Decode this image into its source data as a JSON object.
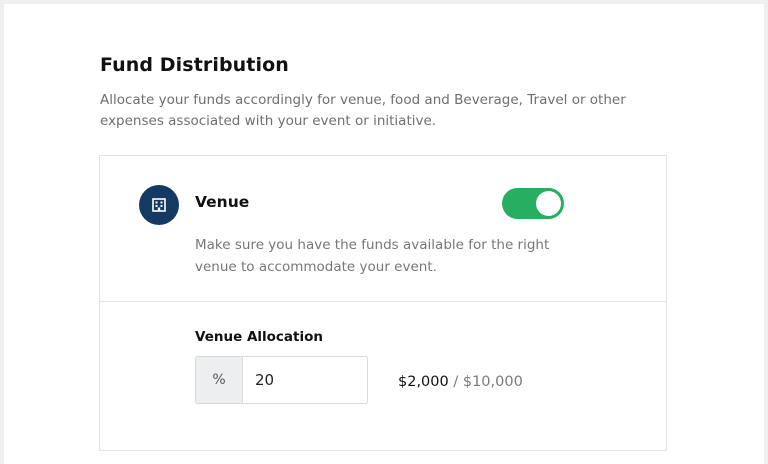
{
  "section": {
    "title": "Fund Distribution",
    "description": "Allocate your funds accordingly for venue, food and Beverage, Travel or other expenses associated with your event or initiative."
  },
  "venue": {
    "icon": "building-icon",
    "title": "Venue",
    "enabled": true,
    "description": "Make sure you have the funds available for the right venue to accommodate your event."
  },
  "allocation": {
    "label": "Venue Allocation",
    "unit": "%",
    "value": "20",
    "allocated": "$2,000",
    "separator": " / ",
    "total": "$10,000"
  },
  "colors": {
    "icon_bg": "#143a63",
    "toggle_on": "#27ae60"
  }
}
